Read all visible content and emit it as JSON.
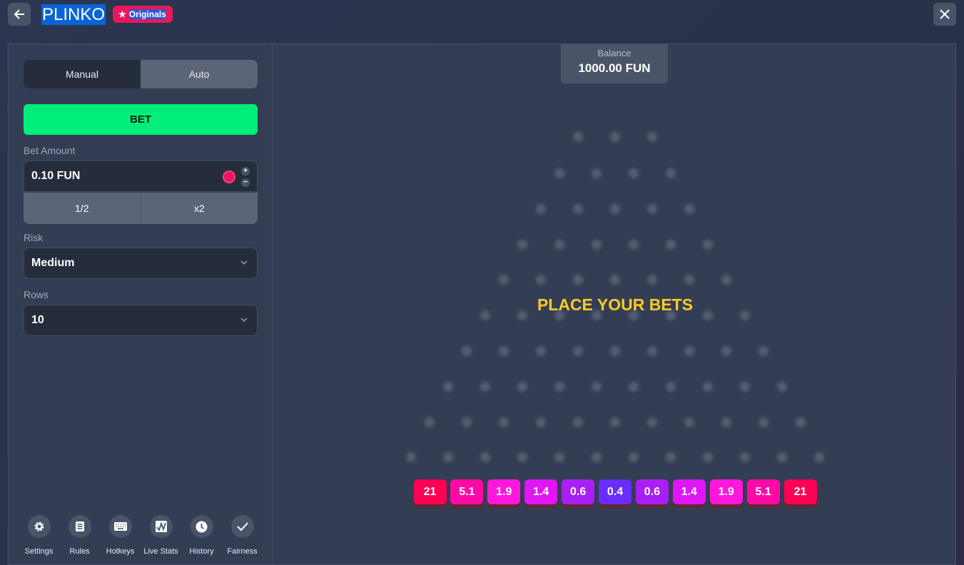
{
  "header": {
    "title": "PLINKO",
    "badge": "Originals",
    "back_icon": "arrow-left-icon",
    "close_icon": "close-icon"
  },
  "controls": {
    "tabs": [
      {
        "label": "Manual",
        "active": true
      },
      {
        "label": "Auto",
        "active": false
      }
    ],
    "bet_label": "BET",
    "bet_amount_label": "Bet Amount",
    "bet_amount_value": "0.10 FUN",
    "half_label": "1/2",
    "double_label": "x2",
    "risk_label": "Risk",
    "risk_value": "Medium",
    "rows_label": "Rows",
    "rows_value": "10"
  },
  "footer_icons": [
    {
      "label": "Settings",
      "icon": "gear-icon"
    },
    {
      "label": "Rules",
      "icon": "document-icon"
    },
    {
      "label": "Hotkeys",
      "icon": "keyboard-icon"
    },
    {
      "label": "Live Stats",
      "icon": "chart-icon"
    },
    {
      "label": "History",
      "icon": "clock-icon"
    },
    {
      "label": "Fairness",
      "icon": "check-icon"
    }
  ],
  "balance": {
    "label": "Balance",
    "value": "1000.00 FUN"
  },
  "status": "PLACE YOUR BETS",
  "multipliers": [
    {
      "value": "21",
      "color": "#ff0055"
    },
    {
      "value": "5.1",
      "color": "#ff0aa6"
    },
    {
      "value": "1.9",
      "color": "#ff18dc"
    },
    {
      "value": "1.4",
      "color": "#e016f7"
    },
    {
      "value": "0.6",
      "color": "#a91ff6"
    },
    {
      "value": "0.4",
      "color": "#6a2cff"
    },
    {
      "value": "0.6",
      "color": "#a91ff6"
    },
    {
      "value": "1.4",
      "color": "#e016f7"
    },
    {
      "value": "1.9",
      "color": "#ff18dc"
    },
    {
      "value": "5.1",
      "color": "#ff0aa6"
    },
    {
      "value": "21",
      "color": "#ff0055"
    }
  ]
}
